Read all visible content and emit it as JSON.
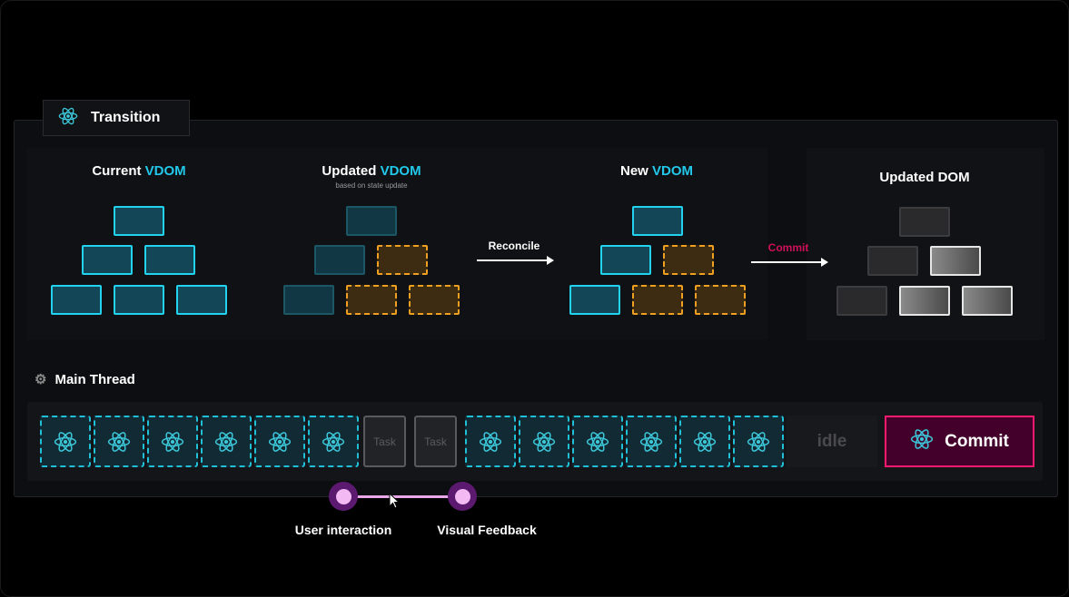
{
  "tab": {
    "label": "Transition",
    "icon": "react-icon"
  },
  "sections": {
    "current": {
      "title_main": "Current ",
      "title_hl": "VDOM",
      "nodes": [
        "unchanged",
        "unchanged",
        "unchanged",
        "unchanged",
        "unchanged",
        "unchanged"
      ]
    },
    "updated": {
      "title_main": "Updated ",
      "title_hl": "VDOM",
      "subtitle": "based on state update",
      "nodes": [
        "stale",
        "stale",
        "updated",
        "stale",
        "updated",
        "updated"
      ]
    },
    "new": {
      "title_main": "New ",
      "title_hl": "VDOM",
      "nodes": [
        "unchanged",
        "unchanged",
        "updated",
        "unchanged",
        "updated",
        "updated"
      ]
    },
    "dom": {
      "title": "Updated DOM",
      "nodes": [
        "dark",
        "dark",
        "light",
        "dark",
        "light",
        "light"
      ]
    }
  },
  "arrows": {
    "reconcile": "Reconcile",
    "commit": "Commit"
  },
  "main_thread": {
    "label": "Main Thread",
    "icon": "gear-icon",
    "cells": [
      "react",
      "react",
      "react",
      "react",
      "react",
      "react",
      "task",
      "task",
      "react",
      "react",
      "react",
      "react",
      "react",
      "react"
    ],
    "task_label": "Task",
    "idle_label": "idle",
    "commit_label": "Commit"
  },
  "timeline": {
    "start": "User interaction",
    "end": "Visual Feedback"
  },
  "colors": {
    "accent": "#22d3f0",
    "updated": "#f0a020",
    "commit": "#ff1a6e",
    "timeline": "#5b1a70"
  }
}
